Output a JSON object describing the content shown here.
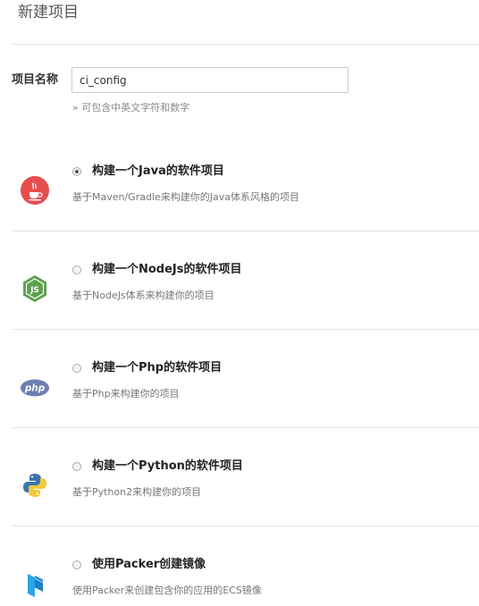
{
  "header": {
    "title": "新建项目"
  },
  "form": {
    "name_label": "项目名称",
    "name_value": "ci_config",
    "name_hint": "» 可包含中英文字符和数字"
  },
  "options": [
    {
      "title": "构建一个Java的软件项目",
      "description": "基于Maven/Gradle来构建你的Java体系风格的项目",
      "selected": true,
      "icon": "java-icon",
      "color": "#e84d4d"
    },
    {
      "title": "构建一个NodeJs的软件项目",
      "description": "基于NodeJs体系来构建你的项目",
      "selected": false,
      "icon": "nodejs-icon",
      "color": "#5fa04e"
    },
    {
      "title": "构建一个Php的软件项目",
      "description": "基于Php来构建你的项目",
      "selected": false,
      "icon": "php-icon",
      "color": "#6e7db3"
    },
    {
      "title": "构建一个Python的软件项目",
      "description": "基于Python2来构建你的项目",
      "selected": false,
      "icon": "python-icon",
      "color": "#3a75b0"
    },
    {
      "title": "使用Packer创建镜像",
      "description": "使用Packer来创建包含你的应用的ECS镜像",
      "selected": false,
      "icon": "packer-icon",
      "color": "#1e90d6"
    }
  ]
}
